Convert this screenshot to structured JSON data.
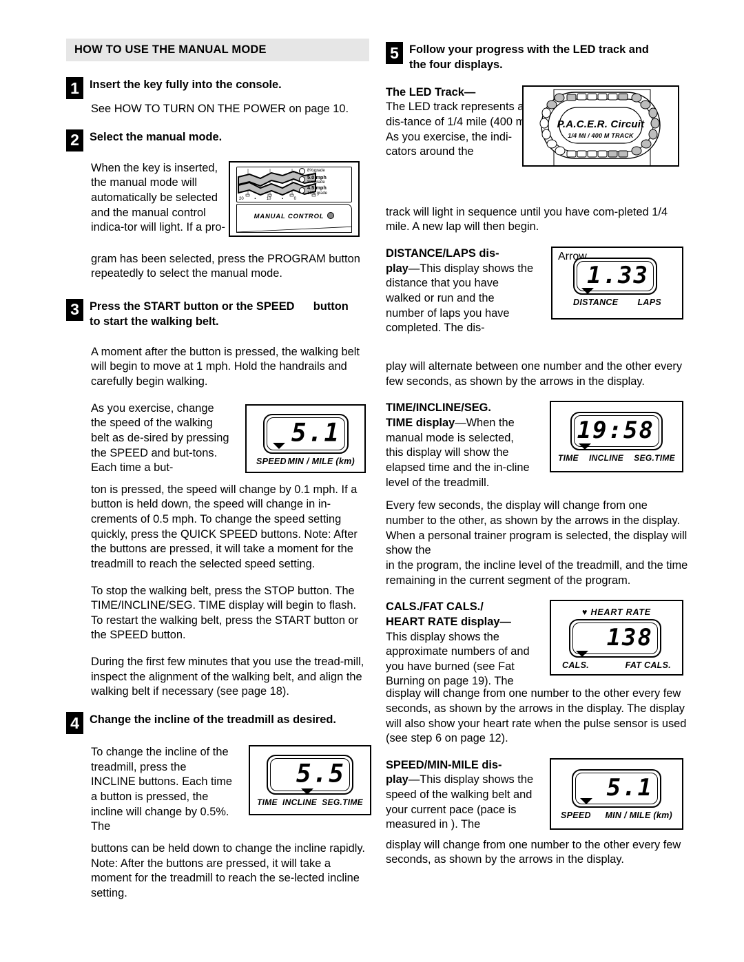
{
  "left": {
    "section_title": "HOW TO USE THE MANUAL MODE",
    "step1": {
      "num": "1",
      "heading": "Insert the key fully into the console.",
      "body": "See HOW TO TURN ON THE POWER on page 10."
    },
    "step2": {
      "num": "2",
      "heading": "Select the manual mode.",
      "body_narrow": "When the key is inserted, the manual mode will automatically be selected and the manual control indica-tor will light. If a pro-",
      "body_full": "gram has been selected, press the PROGRAM button repeatedly to select the manual mode."
    },
    "console_figure": {
      "manual_control_label": "MANUAL CONTROL",
      "legend": [
        {
          "speed": "",
          "grade": "8% grade"
        },
        {
          "speed": "5.0 mph",
          "grade": "8% grade"
        },
        {
          "speed": "4.5 mph",
          "grade": "10% grade"
        }
      ],
      "axis": [
        "20",
        "▪",
        "10",
        "▪",
        "0"
      ]
    },
    "step3": {
      "num": "3",
      "heading_line1": "Press the START button or the SPEED      button",
      "heading_line2": "to start the walking belt.",
      "p1": "A moment after the button is pressed, the walking belt will begin to move at 1 mph. Hold the handrails and carefully begin walking.",
      "p2_narrow": "As you exercise, change the speed of the walking belt as de-sired by pressing the SPEED     and     but-tons. Each time a but-",
      "p2_full": "ton is pressed, the speed will change by 0.1 mph. If a button is held down, the speed will change in in-crements of 0.5 mph. To change the speed setting quickly, press the QUICK SPEED buttons. Note: After the buttons are pressed, it will take a moment for the treadmill to reach the selected speed setting.",
      "p3": "To stop the walking belt, press the STOP button. The TIME/INCLINE/SEG. TIME display will begin to flash. To restart the walking belt, press the START button or the SPEED     button.",
      "p4": "During the first few minutes that you use the tread-mill, inspect the alignment of the walking belt, and align the walking belt if necessary (see page 18)."
    },
    "speed_display": {
      "value": "5.1",
      "label_left": "SPEED",
      "label_right": "MIN / MILE (km)"
    },
    "step4": {
      "num": "4",
      "heading": "Change the incline of the treadmill as desired.",
      "body_narrow": "To change the incline of the treadmill, press the INCLINE buttons. Each time a button is pressed, the incline will change by 0.5%. The",
      "body_full": "buttons can be held down to change the incline rapidly. Note: After the buttons are pressed, it will take a moment for the treadmill to reach the se-lected incline setting."
    },
    "incline_display": {
      "value": "5.5",
      "label_left": "TIME",
      "label_mid": "INCLINE",
      "label_right": "SEG.TIME"
    }
  },
  "right": {
    "step5": {
      "num": "5",
      "heading_line1": "Follow your progress with the LED track and",
      "heading_line2": "the four displays."
    },
    "led_track": {
      "subhead": "The LED Track—",
      "body_narrow": "The LED track represents a dis-tance of 1/4 mile (400 m). As you exercise, the indi-cators around the",
      "body_full": "track will light in sequence until you have com-pleted 1/4 mile. A new lap will then begin.",
      "brand": "P.A.C.E.R. Circuit",
      "sub_brand": "1/4 MI  /  400 M  TRACK"
    },
    "distance_laps": {
      "subhead_line1": "DISTANCE/LAPS dis-",
      "subhead_line2": "play",
      "body_narrow": "—This display shows the distance that you have walked or run and the number of laps you have completed. The dis-",
      "body_full": "play will alternate between one number and the other every few seconds, as shown by the arrows in the display.",
      "arrow_label": "Arrow",
      "value": "1.33",
      "label_left": "DISTANCE",
      "label_right": "LAPS"
    },
    "time_incline": {
      "subhead_line1": "TIME/INCLINE/SEG.",
      "subhead_line2": "TIME display",
      "body_narrow": "—When the manual mode is selected, this display will show the elapsed time and the in-cline level of the treadmill.",
      "body_full": "Every few seconds, the display will change from one number to the other, as shown by the arrows in the display. When a personal trainer program is selected, the display will show the",
      "body_full2": "in the program, the incline level of the treadmill, and the time remaining in the current segment of the program.",
      "value": "19:58",
      "label_left": "TIME",
      "label_mid": "INCLINE",
      "label_right": "SEG.TIME"
    },
    "cals_hr": {
      "subhead_line1": "CALS./FAT CALS./",
      "subhead_line2": "HEART RATE display—",
      "body_narrow": "This display shows the approximate numbers of                      and",
      "body_narrow2": "you have burned (see Fat Burning on page 19). The",
      "body_full": "display will change from one number to the other every few seconds, as shown by the arrows in the display. The display will also show your heart rate when the pulse sensor is used (see step 6 on page 12).",
      "hr_label": "HEART RATE",
      "value": "138",
      "label_left": "CALS.",
      "label_right": "FAT CALS."
    },
    "speed_min_mile": {
      "subhead_line1": "SPEED/MIN-MILE dis-",
      "subhead_line2": "play",
      "body_narrow": "—This display shows the speed of the walking belt and your current pace (pace is measured in                           ). The",
      "body_full": "display will change from one number to the other every few seconds, as shown by the arrows in the display.",
      "value": "5.1",
      "label_left": "SPEED",
      "label_right": "MIN / MILE (km)"
    }
  }
}
